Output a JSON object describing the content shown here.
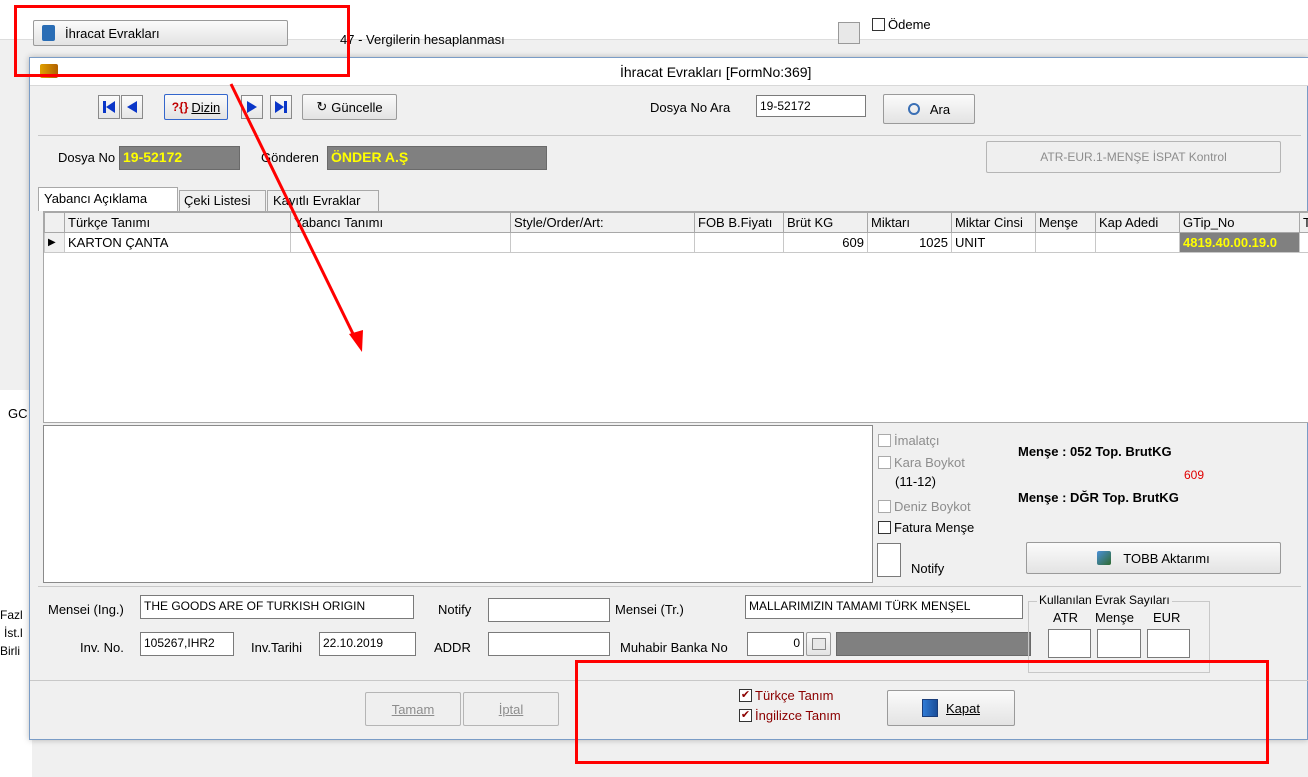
{
  "background": {
    "top_button": "İhracat Evrakları",
    "top_item": "47 - Vergilerin hesaplanması",
    "odeme_label": "Ödeme",
    "left_fragments": [
      "GC",
      "Fazl",
      "İst.l",
      "Birli"
    ]
  },
  "window": {
    "title": "İhracat Evrakları [FormNo:369]"
  },
  "toolbar": {
    "dizin_label": "Dizin",
    "guncelle_label": "Güncelle",
    "dosya_no_ara_label": "Dosya No Ara",
    "dosya_no_ara_value": "19-52172",
    "ara_label": "Ara"
  },
  "header": {
    "dosya_no_label": "Dosya No",
    "dosya_no_value": "19-52172",
    "gonderen_label": "Gönderen",
    "gonderen_value": "ÖNDER A.Ş",
    "atr_button": "ATR-EUR.1-MENŞE İSPAT Kontrol"
  },
  "tabs": [
    {
      "label": "Yabancı Açıklama"
    },
    {
      "label": "Çeki Listesi"
    },
    {
      "label": "Kayıtlı Evraklar"
    }
  ],
  "grid": {
    "columns": [
      "Türkçe Tanımı",
      "Yabancı Tanımı",
      "Style/Order/Art:",
      "FOB B.Fiyatı",
      "Brüt KG",
      "Miktarı",
      "Miktar Cinsi",
      "Menşe",
      "Kap Adedi",
      "GTip_No",
      "T"
    ],
    "rows": [
      {
        "turkce": "KARTON ÇANTA",
        "yabanci": "",
        "style": "",
        "fob": "",
        "brut": "609",
        "miktar": "1025",
        "cinsi": "UNIT",
        "mense": "",
        "kap": "",
        "gtip": "4819.40.00.19.0"
      }
    ]
  },
  "options": {
    "imalatci": "İmalatçı",
    "kara_boykot": "Kara Boykot",
    "kara_boykot_sub": "(11-12)",
    "deniz_boykot": "Deniz Boykot",
    "fatura_mense": "Fatura Menşe",
    "notify_label": "Notify"
  },
  "totals": {
    "mense1": "Menşe : 052  Top. BrutKG",
    "mense1_value": "609",
    "mense2": "Menşe : DĞR  Top. BrutKG",
    "tobb_button": "TOBB Aktarımı"
  },
  "form": {
    "mensei_ing_label": "Mensei (Ing.)",
    "mensei_ing_value": "THE GOODS ARE OF TURKISH ORIGIN",
    "notify_label": "Notify",
    "notify_value": "",
    "mensei_tr_label": "Mensei (Tr.)",
    "mensei_tr_value": "MALLARIMIZIN TAMAMI TÜRK MENŞEL",
    "inv_no_label": "Inv. No.",
    "inv_no_value": "105267,IHR2",
    "inv_tarihi_label": "Inv.Tarihi",
    "inv_tarihi_value": "22.10.2019",
    "addr_label": "ADDR",
    "addr_value": "",
    "muhabir_label": "Muhabir Banka No",
    "muhabir_value": "0"
  },
  "evrak": {
    "title": "Kullanılan Evrak Sayıları",
    "atr": "ATR",
    "mense": "Menşe",
    "eur": "EUR"
  },
  "footer": {
    "tamam": "Tamam",
    "iptal": "İptal",
    "turkce_tanim": "Türkçe Tanım",
    "ingilizce_tanim": "İngilizce Tanım",
    "kapat": "Kapat"
  },
  "colors": {
    "highlight_yellow": "#ffff00",
    "gray_field": "#808080",
    "annotation_red": "#ff0000",
    "dark_red_text": "#8b0000"
  }
}
